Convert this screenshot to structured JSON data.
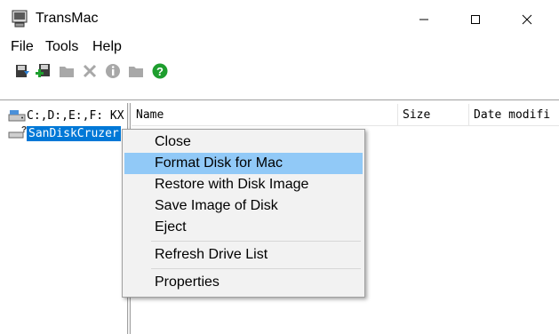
{
  "window": {
    "title": "TransMac",
    "controls": {
      "minimize": "minimize",
      "maximize": "maximize",
      "close": "close"
    }
  },
  "menubar": {
    "items": [
      "File",
      "Tools",
      "Help"
    ]
  },
  "toolbar": {
    "buttons": [
      {
        "icon": "open-disk-icon",
        "enabled": true
      },
      {
        "icon": "add-disk-icon",
        "enabled": true
      },
      {
        "icon": "folder-icon",
        "enabled": false
      },
      {
        "icon": "delete-icon",
        "enabled": false
      },
      {
        "icon": "info-icon",
        "enabled": false
      },
      {
        "icon": "new-folder-icon",
        "enabled": false
      },
      {
        "icon": "help-icon",
        "enabled": true
      }
    ]
  },
  "tree": {
    "items": [
      {
        "label": "C:,D:,E:,F: KX",
        "icon": "drive-icon",
        "selected": false
      },
      {
        "label": "SanDiskCruzer",
        "icon": "usb-disk-icon",
        "selected": true
      }
    ]
  },
  "list": {
    "columns": [
      "Name",
      "Size",
      "Date modifi"
    ]
  },
  "context_menu": {
    "items": [
      {
        "label": "Close",
        "hover": false
      },
      {
        "label": "Format Disk for Mac",
        "hover": true
      },
      {
        "label": "Restore with Disk Image",
        "hover": false
      },
      {
        "label": "Save Image of Disk",
        "hover": false
      },
      {
        "label": "Eject",
        "hover": false
      },
      {
        "label": "Refresh Drive List",
        "hover": false
      },
      {
        "label": "Properties",
        "hover": false
      }
    ]
  },
  "colors": {
    "selection": "#0078d7",
    "menu_hover": "#91c9f7",
    "help_green": "#1e9e2e",
    "disabled_gray": "#a8a8a8"
  }
}
